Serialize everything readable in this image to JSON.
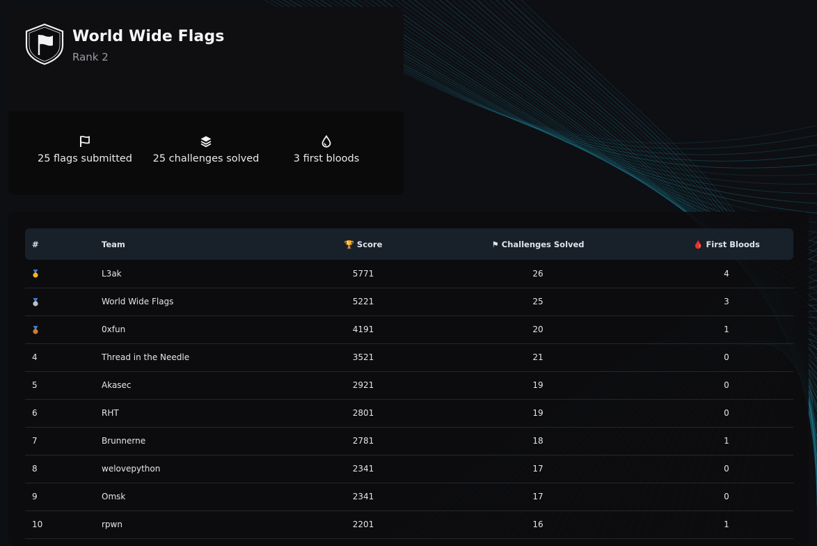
{
  "team": {
    "name": "World Wide Flags",
    "rank_label": "Rank 2",
    "emblem_icon": "flag-shield-icon"
  },
  "stats": [
    {
      "icon": "flag-icon",
      "label": "25 flags submitted"
    },
    {
      "icon": "layers-icon",
      "label": "25 challenges solved"
    },
    {
      "icon": "droplet-icon",
      "label": "3 first bloods"
    }
  ],
  "leaderboard": {
    "columns": {
      "rank": "#",
      "team": "Team",
      "score": "🏆 Score",
      "solved": "⚑  Challenges Solved",
      "first_bloods": "🩸 First Bloods"
    },
    "rows": [
      {
        "rank": "",
        "medal": "gold-medal-icon",
        "team": "L3ak",
        "score": "5771",
        "solved": "26",
        "first_bloods": "4"
      },
      {
        "rank": "",
        "medal": "silver-medal-icon",
        "team": "World Wide Flags",
        "score": "5221",
        "solved": "25",
        "first_bloods": "3"
      },
      {
        "rank": "",
        "medal": "bronze-medal-icon",
        "team": "0xfun",
        "score": "4191",
        "solved": "20",
        "first_bloods": "1"
      },
      {
        "rank": "4",
        "medal": "",
        "team": "Thread in the Needle",
        "score": "3521",
        "solved": "21",
        "first_bloods": "0"
      },
      {
        "rank": "5",
        "medal": "",
        "team": "Akasec",
        "score": "2921",
        "solved": "19",
        "first_bloods": "0"
      },
      {
        "rank": "6",
        "medal": "",
        "team": "RHT",
        "score": "2801",
        "solved": "19",
        "first_bloods": "0"
      },
      {
        "rank": "7",
        "medal": "",
        "team": "Brunnerne",
        "score": "2781",
        "solved": "18",
        "first_bloods": "1"
      },
      {
        "rank": "8",
        "medal": "",
        "team": "welovepython",
        "score": "2341",
        "solved": "17",
        "first_bloods": "0"
      },
      {
        "rank": "9",
        "medal": "",
        "team": "Omsk",
        "score": "2341",
        "solved": "17",
        "first_bloods": "0"
      },
      {
        "rank": "10",
        "medal": "",
        "team": "rpwn",
        "score": "2201",
        "solved": "16",
        "first_bloods": "1"
      }
    ]
  },
  "colors": {
    "background": "#0e0f13",
    "card": "#0c0c0e",
    "accent_lines": "#1f8ea8",
    "gold": "#f0b429",
    "silver": "#b8c2cc",
    "bronze": "#cd7f32"
  }
}
